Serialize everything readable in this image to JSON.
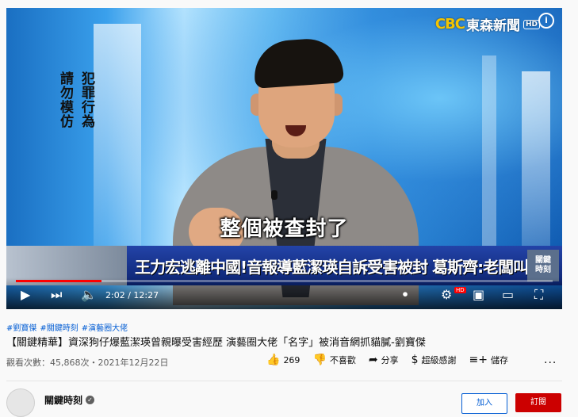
{
  "video": {
    "warning_line1": "犯罪行為",
    "warning_line2": "請勿模仿",
    "channel_logo_cbc": "CBC",
    "channel_logo_name": "東森新聞",
    "channel_logo_hd": "HD",
    "subtitle": "整個被查封了",
    "ticker_text": "王力宏逃離中國!音報導藍潔瑛自訴受害被封 葛斯齊:老闆叫我快跑!",
    "ticker_badge_line1": "關鍵",
    "ticker_badge_line2": "時刻",
    "progress_fraction": 0.16,
    "time_display": "2:02 / 12:27"
  },
  "controls_icons": {
    "play": "play-icon",
    "next": "next-icon",
    "volume": "volume-icon",
    "settings": "settings-icon",
    "miniplayer": "miniplayer-icon",
    "theater": "theater-icon",
    "fullscreen": "fullscreen-icon"
  },
  "hashtags": [
    "#劉寶傑",
    "#關鍵時刻",
    "#演藝圈大佬"
  ],
  "title": "【關鍵精華】資深狗仔爆藍潔瑛曾親曝受害經歷 演藝圈大佬「名字」被消音網抓貓膩-劉寶傑",
  "views": "觀看次數：45,868次・2021年12月22日",
  "actions": {
    "like_count": "269",
    "dislike_label": "不喜歡",
    "share_label": "分享",
    "thanks_label": "超級感謝",
    "save_label": "儲存",
    "more_label": "..."
  },
  "channel": {
    "name": "關鍵時刻",
    "join_label": "加入",
    "subscribe_label": "訂閱"
  },
  "colors": {
    "progress": "#ff0000",
    "subscribe": "#cc0000",
    "link": "#065fd4"
  }
}
